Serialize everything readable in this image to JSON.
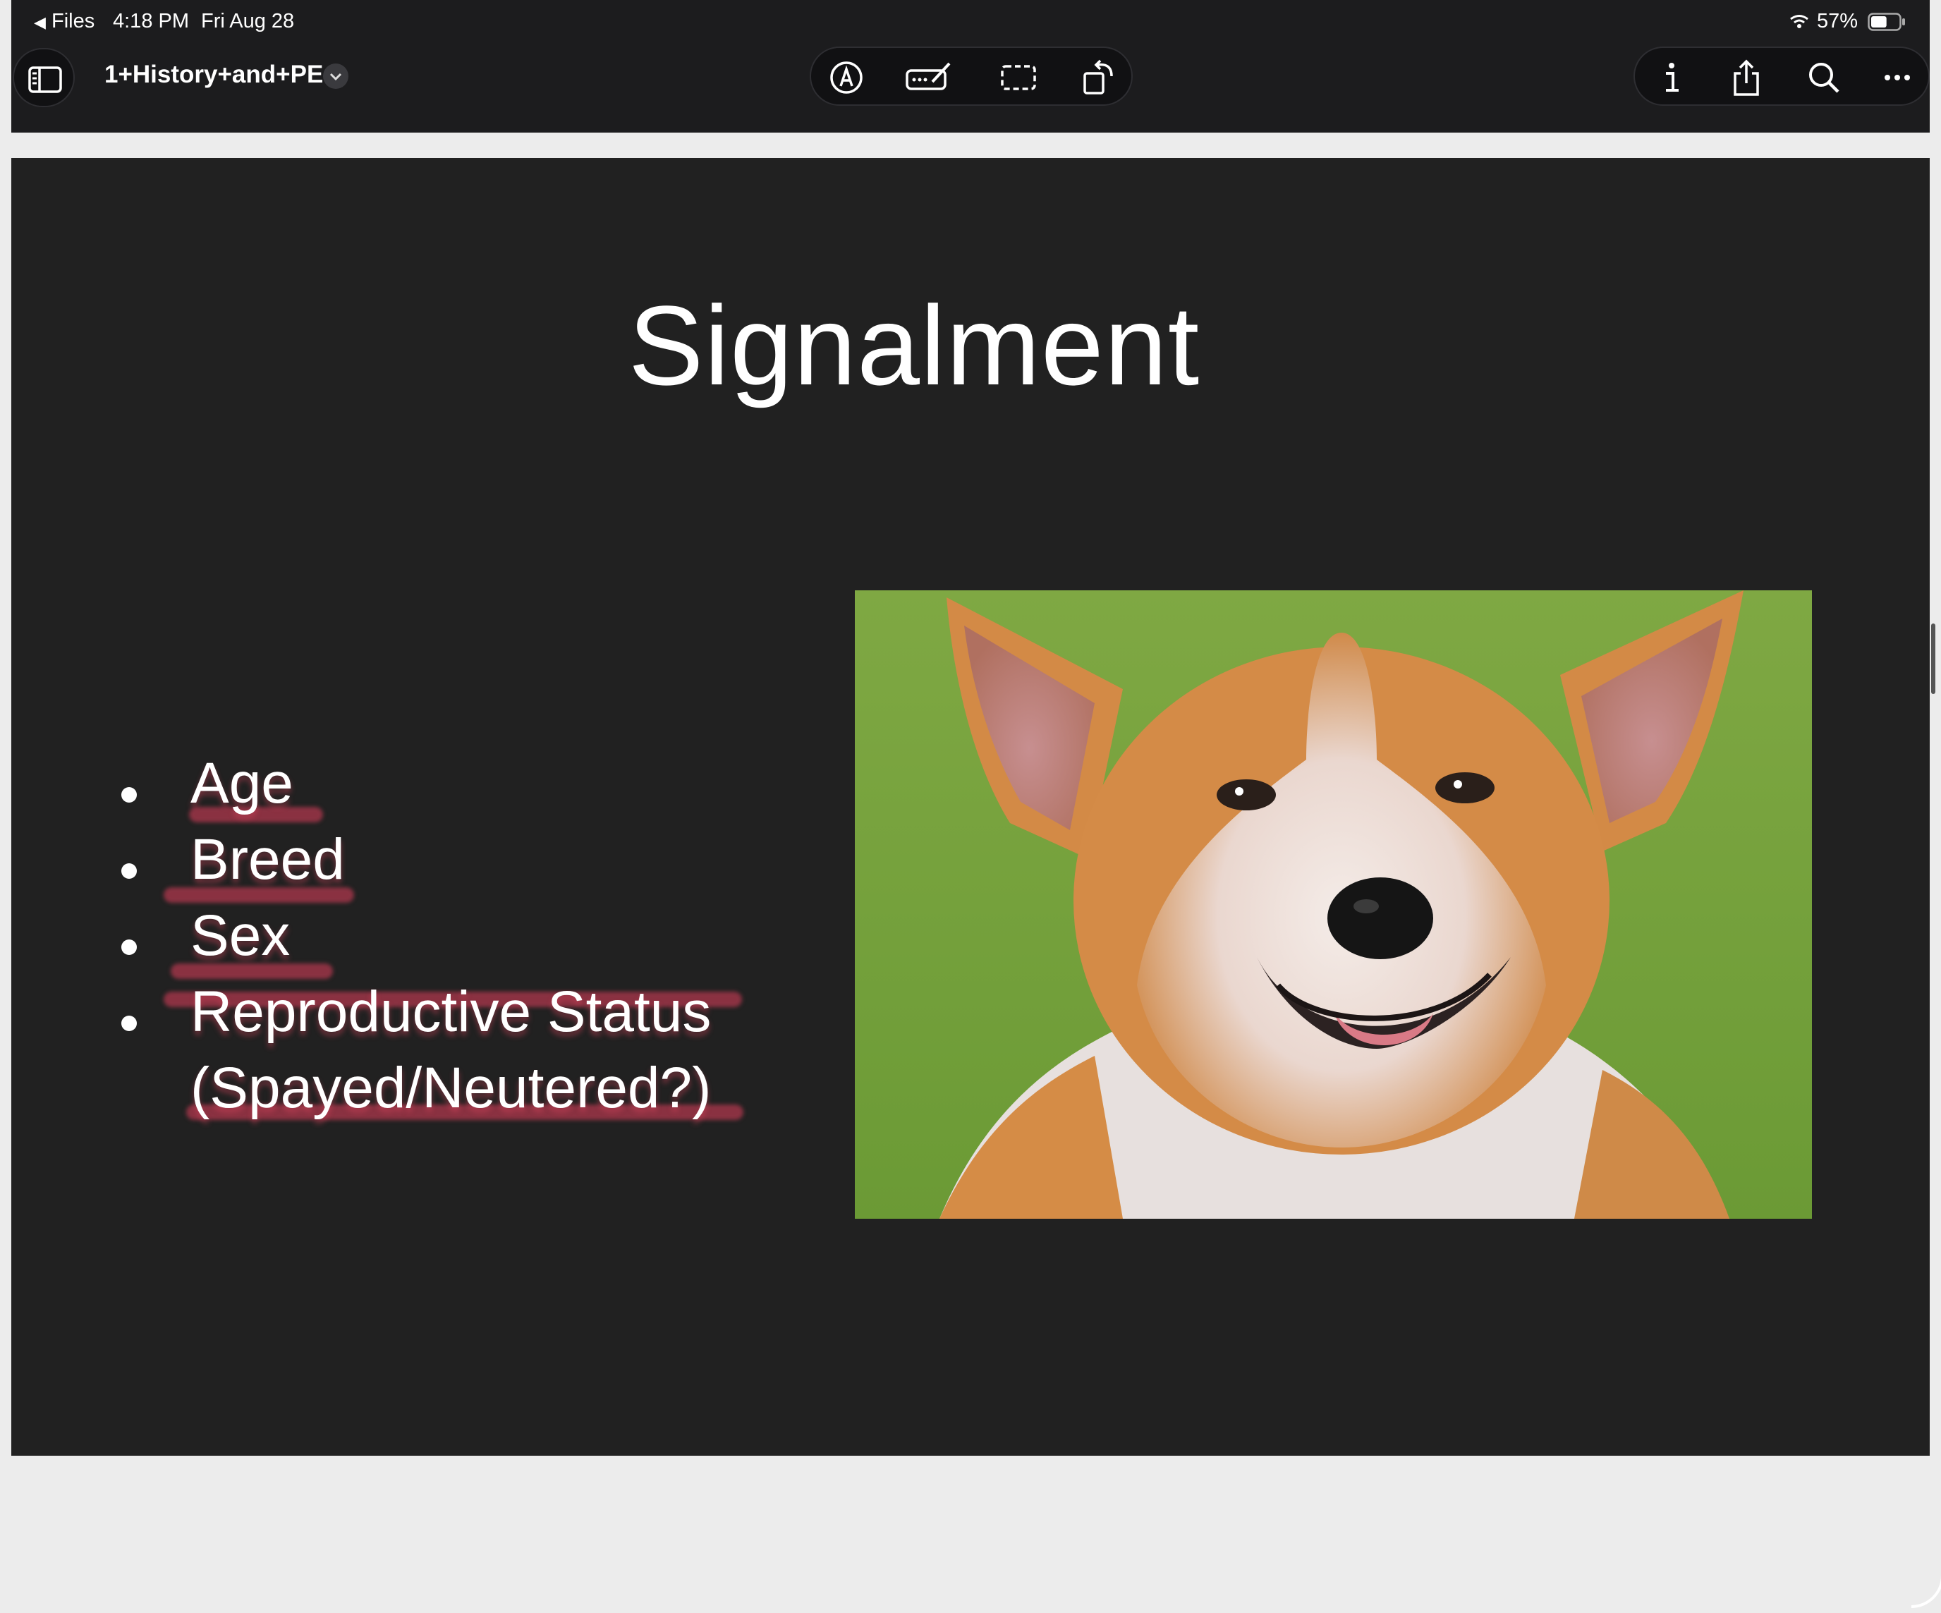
{
  "status_bar": {
    "back_label": "Files",
    "time": "4:18 PM",
    "date": "Fri Aug 28",
    "battery_percent": "57%",
    "battery_level": 0.57
  },
  "toolbar": {
    "document_title": "1+History+and+PE",
    "center_icons": [
      "markup-icon",
      "text-input-icon",
      "selection-icon",
      "rotate-icon"
    ],
    "right_icons": [
      "info-icon",
      "share-icon",
      "search-icon",
      "more-icon"
    ]
  },
  "slide": {
    "title": "Signalment",
    "bullets": [
      "Age",
      "Breed",
      "Sex",
      "Reproductive Status",
      "(Spayed/Neutered?)"
    ],
    "image_description": "smiling corgi on grass"
  },
  "colors": {
    "background": "#212121",
    "toolbar": "#1c1c1e",
    "highlight": "#e2405c"
  }
}
